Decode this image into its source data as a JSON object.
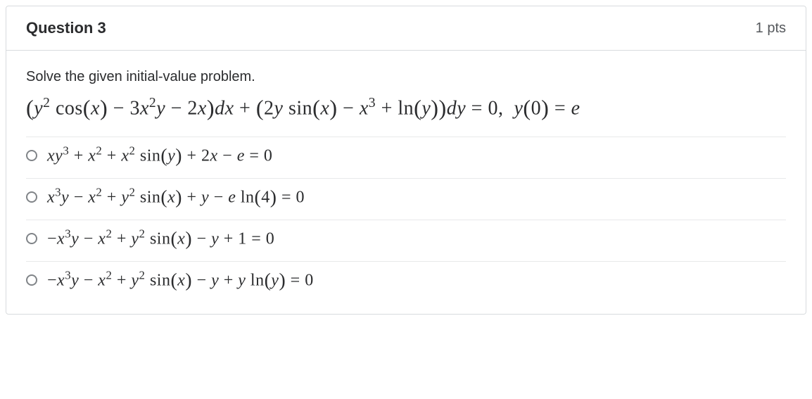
{
  "header": {
    "title": "Question 3",
    "points": "1 pts"
  },
  "prompt": "Solve the given initial-value problem.",
  "equation_html": "<span class=\"paren-lg\">(</span><i>y</i><sup>2</sup> cos<span class=\"paren-lg\">(</span><i>x</i><span class=\"paren-lg\">)</span> − 3<i>x</i><sup>2</sup><i>y</i> − 2<i>x</i><span class=\"paren-lg\">)</span><i>dx</i> + <span class=\"paren-lg\">(</span>2<i>y</i> sin<span class=\"paren-lg\">(</span><i>x</i><span class=\"paren-lg\">)</span> − <i>x</i><sup>3</sup> + ln<span class=\"paren-lg\">(</span><i>y</i><span class=\"paren-lg\">)</span><span class=\"paren-lg\">)</span><i>dy</i> = 0,&nbsp;&nbsp;<i>y</i><span class=\"paren-lg\">(</span>0<span class=\"paren-lg\">)</span> = <i>e</i>",
  "options": [
    {
      "html": "<i>xy</i><sup>3</sup> + <i>x</i><sup>2</sup> + <i>x</i><sup>2</sup> sin<span class=\"paren-lg\">(</span><i>y</i><span class=\"paren-lg\">)</span> + 2<i>x</i> − <i>e</i> = 0"
    },
    {
      "html": "<i>x</i><sup>3</sup><i>y</i> − <i>x</i><sup>2</sup> + <i>y</i><sup>2</sup> sin<span class=\"paren-lg\">(</span><i>x</i><span class=\"paren-lg\">)</span> + <i>y</i> − <i>e</i> ln<span class=\"paren-lg\">(</span>4<span class=\"paren-lg\">)</span> = 0"
    },
    {
      "html": "−<i>x</i><sup>3</sup><i>y</i> − <i>x</i><sup>2</sup> + <i>y</i><sup>2</sup> sin<span class=\"paren-lg\">(</span><i>x</i><span class=\"paren-lg\">)</span> − <i>y</i> + 1 = 0"
    },
    {
      "html": "−<i>x</i><sup>3</sup><i>y</i> − <i>x</i><sup>2</sup> + <i>y</i><sup>2</sup> sin<span class=\"paren-lg\">(</span><i>x</i><span class=\"paren-lg\">)</span> − <i>y</i> + <i>y</i> ln<span class=\"paren-lg\">(</span><i>y</i><span class=\"paren-lg\">)</span> = 0"
    }
  ]
}
